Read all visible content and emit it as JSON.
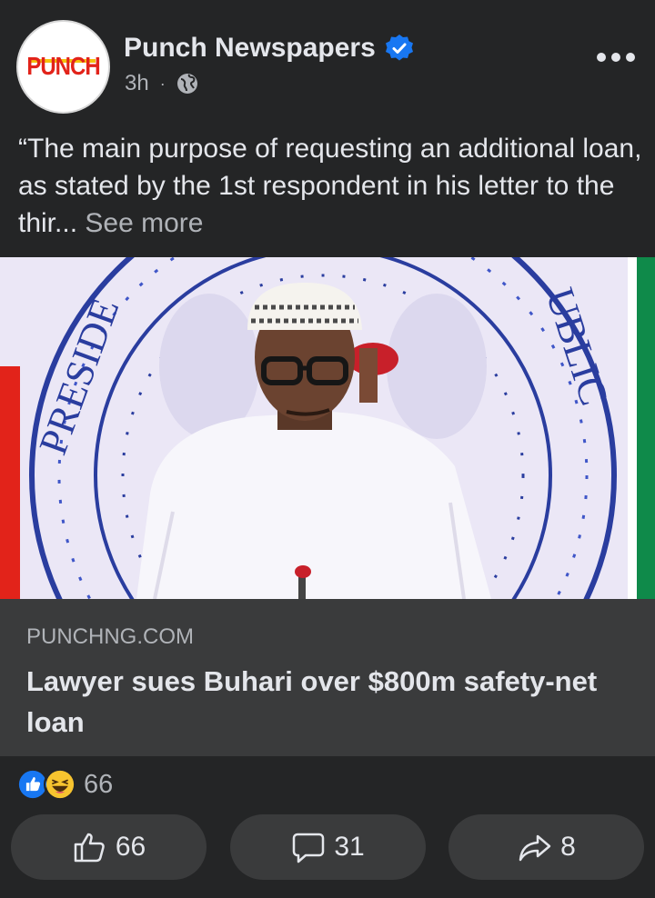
{
  "header": {
    "avatar_text": "PUNCH",
    "page_name": "Punch Newspapers",
    "time": "3h",
    "separator": "·"
  },
  "post": {
    "text": "“The main purpose of requesting an additional loan, as stated by the 1st respondent in his letter to the thir...",
    "see_more": "See more"
  },
  "link": {
    "domain": "PUNCHNG.COM",
    "title": "Lawyer sues Buhari over $800m safety-net loan"
  },
  "reactions": {
    "count": "66"
  },
  "actions": {
    "like_count": "66",
    "comment_count": "31",
    "share_count": "8"
  },
  "icons": {
    "verified": "verified-badge-icon",
    "audience": "globe-icon",
    "like": "thumbs-up-icon",
    "comment": "comment-bubble-icon",
    "share": "share-arrow-icon"
  },
  "colors": {
    "background": "#242526",
    "card": "#3a3b3c",
    "text": "#e4e6eb",
    "muted": "#b0b3b8",
    "accent": "#1877f2",
    "brand_red": "#e2231a"
  }
}
